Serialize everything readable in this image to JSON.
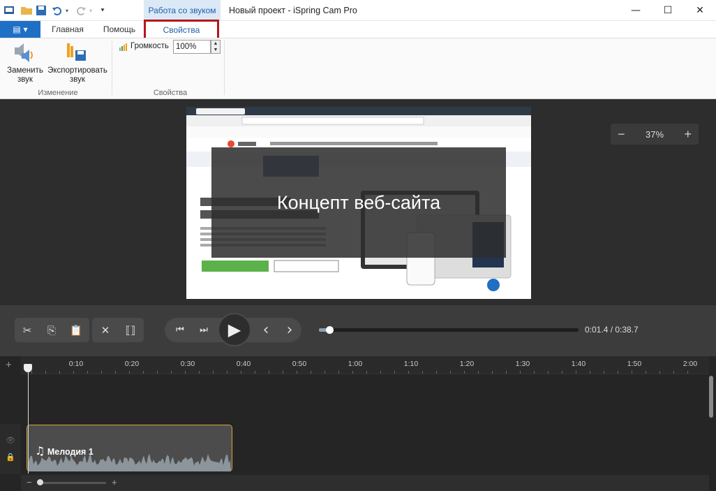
{
  "window": {
    "title": "Новый проект - iSpring Cam Pro",
    "context_tab": "Работа со звуком",
    "controls": {
      "minimize": "—",
      "maximize": "☐",
      "close": "✕"
    }
  },
  "quick_access": {
    "icons": [
      "app-icon",
      "open-folder-icon",
      "save-icon",
      "undo-icon",
      "redo-icon",
      "customize-icon"
    ]
  },
  "ribbon": {
    "file_menu_icon": "▤ ▾",
    "tabs": [
      "Главная",
      "Помощь",
      "Свойства"
    ],
    "active_tab": "Свойства",
    "groups": {
      "change": {
        "label": "Изменение",
        "replace_sound": "Заменить звук",
        "export_sound": "Экспортировать звук"
      },
      "properties": {
        "label": "Свойства",
        "volume_label": "Громкость",
        "volume_value": "100%"
      }
    }
  },
  "preview": {
    "caption": "Концепт веб-сайта",
    "zoom": "37%",
    "zoom_minus": "−",
    "zoom_plus": "+"
  },
  "playback": {
    "current_time": "0:01.4",
    "total_time": "0:38.7",
    "time_display": "0:01.4 / 0:38.7",
    "progress": 0.04
  },
  "timeline": {
    "ticks": [
      "0:10",
      "0:20",
      "0:30",
      "0:40",
      "0:50",
      "1:00",
      "1:10",
      "1:20",
      "1:30",
      "1:40",
      "1:50",
      "2:00"
    ],
    "clip_name": "Мелодия 1",
    "add_track": "+"
  },
  "colors": {
    "accent_blue": "#1f6fc5",
    "highlight_red": "#b4161b",
    "clip_border": "#d4a73c",
    "waveform": "#8c959c"
  }
}
